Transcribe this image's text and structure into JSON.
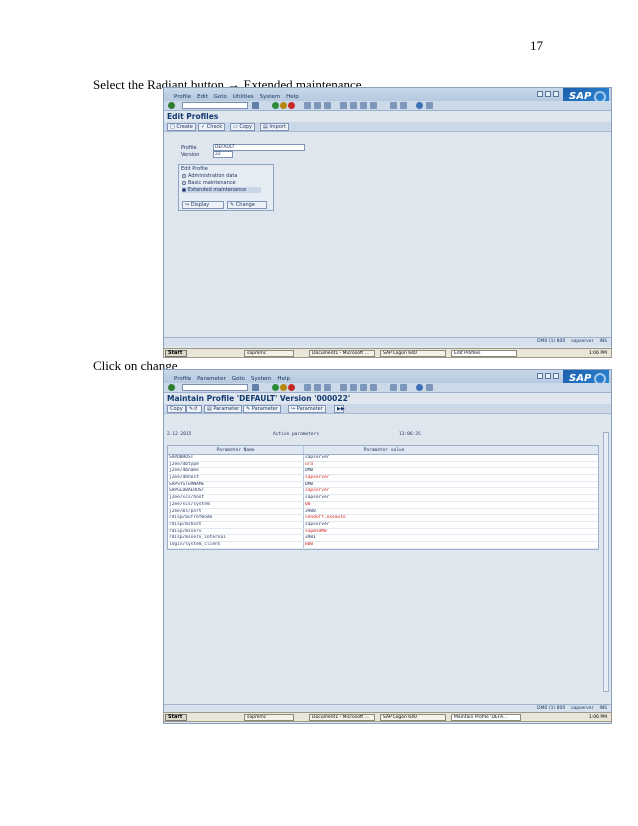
{
  "page_number": "17",
  "instruction1": "Select the Radiant button → Extended maintenance",
  "instruction2": "Click on change",
  "screen1": {
    "menu": [
      "Profile",
      "Edit",
      "Goto",
      "Utilities",
      "System",
      "Help"
    ],
    "title": "Edit Profiles",
    "buttons": [
      "Create",
      "Check",
      "Copy",
      "Import"
    ],
    "profile_label": "Profile",
    "profile_value": "DEFAULT",
    "version_label": "Version",
    "version_value": "22",
    "group_title": "Edit Profile",
    "options": [
      "Administration data",
      "Basic maintenance",
      "Extended maintenance"
    ],
    "display_label": "Display",
    "change_label": "Change",
    "status": [
      "DM0 (1) 800",
      "sapserver",
      "INS"
    ]
  },
  "screen2": {
    "menu": [
      "Profile",
      "Parameter",
      "Goto",
      "System",
      "Help"
    ],
    "title": "Maintain Profile 'DEFAULT' Version '000022'",
    "buttons": [
      "Copy",
      "Parameter",
      "Parameter",
      "Parameter"
    ],
    "date": "2.12.2015",
    "list_title": "Active parameters",
    "time": "13:06:35",
    "col1": "Parameter Name",
    "col2": "Parameter value",
    "rows": [
      {
        "name": "SAPDBHOST",
        "value": "sapserver",
        "red": false
      },
      {
        "name": "j2ee/dbtype",
        "value": "ora",
        "red": true
      },
      {
        "name": "j2ee/dbname",
        "value": "DM0",
        "red": false
      },
      {
        "name": "j2ee/dbhost",
        "value": "sapserver",
        "red": true
      },
      {
        "name": "SAPSYSTEMNAME",
        "value": "DM0",
        "red": false
      },
      {
        "name": "SAPGLOBALHOST",
        "value": "sapserver",
        "red": true
      },
      {
        "name": "j2ee/scs/host",
        "value": "sapserver",
        "red": false
      },
      {
        "name": "j2ee/scs/system",
        "value": "00",
        "red": true
      },
      {
        "name": "j2ee/ms/port",
        "value": "3900",
        "red": false
      },
      {
        "name": "rdisp/bufrefmode",
        "value": "sendoff,exeauto",
        "red": true
      },
      {
        "name": "rdisp/mshost",
        "value": "sapserver",
        "red": false
      },
      {
        "name": "rdisp/msserv",
        "value": "sapmsDM0",
        "red": true
      },
      {
        "name": "rdisp/msserv_internal",
        "value": "3901",
        "red": false
      },
      {
        "name": "login/system_client",
        "value": "800",
        "red": true
      }
    ],
    "status": [
      "DM0 (1) 800",
      "sapserver",
      "INS"
    ]
  },
  "taskbar1": {
    "start": "Start",
    "tasks": [
      "sapmmc",
      "Document1 - Microsoft ...",
      "SAP Logon 640",
      "Edit Profiles"
    ],
    "clock": "1:06 PM"
  },
  "taskbar2": {
    "start": "Start",
    "tasks": [
      "sapmmc",
      "Document1 - Microsoft ...",
      "SAP Logon 640",
      "Maintain Profile 'DEFA..."
    ],
    "clock": "1:06 PM"
  }
}
